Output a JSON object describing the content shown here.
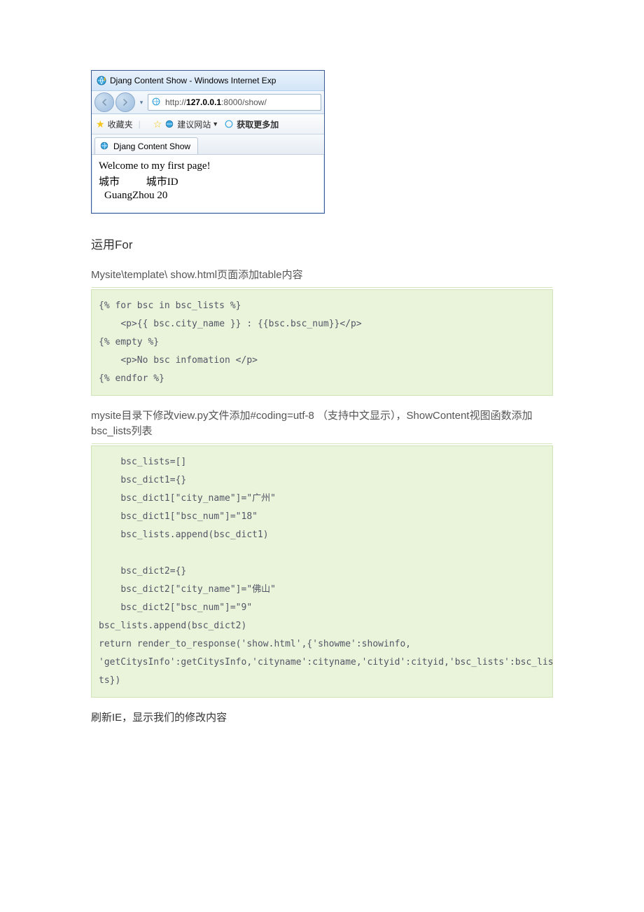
{
  "ie": {
    "title": "Djang Content Show - Windows Internet Exp",
    "url_prefix": "http://",
    "url_host": "127.0.0.1",
    "url_port": ":8000",
    "url_path": "/show/",
    "fav_label": "收藏夹",
    "suggest_label": "建议网站",
    "get_more_label": "获取更多加",
    "tab_label": "Djang Content Show"
  },
  "page": {
    "welcome": "Welcome to my first page!",
    "col_city": "城市",
    "col_cityid": "城市ID",
    "row_city": "GuangZhou",
    "row_id": "20"
  },
  "h_for": "运用For",
  "p_show_desc": "Mysite\\template\\ show.html页面添加table内容",
  "code1": "{% for bsc in bsc_lists %}\n    <p>{{ bsc.city_name }} : {{bsc.bsc_num}}</p>\n{% empty %}\n    <p>No bsc infomation </p>\n{% endfor %}",
  "p_view_desc": "mysite目录下修改view.py文件添加#coding=utf-8 （支持中文显示），ShowContent视图函数添加bsc_lists列表",
  "code2": "    bsc_lists=[]\n    bsc_dict1={}\n    bsc_dict1[\"city_name\"]=\"广州\"\n    bsc_dict1[\"bsc_num\"]=\"18\"\n    bsc_lists.append(bsc_dict1)\n\n    bsc_dict2={}\n    bsc_dict2[\"city_name\"]=\"佛山\"\n    bsc_dict2[\"bsc_num\"]=\"9\"\nbsc_lists.append(bsc_dict2)\nreturn render_to_response('show.html',{'showme':showinfo,\n'getCitysInfo':getCitysInfo,'cityname':cityname,'cityid':cityid,'bsc_lists':bsc_lis\nts})",
  "p_refresh": "刷新IE，显示我们的修改内容"
}
